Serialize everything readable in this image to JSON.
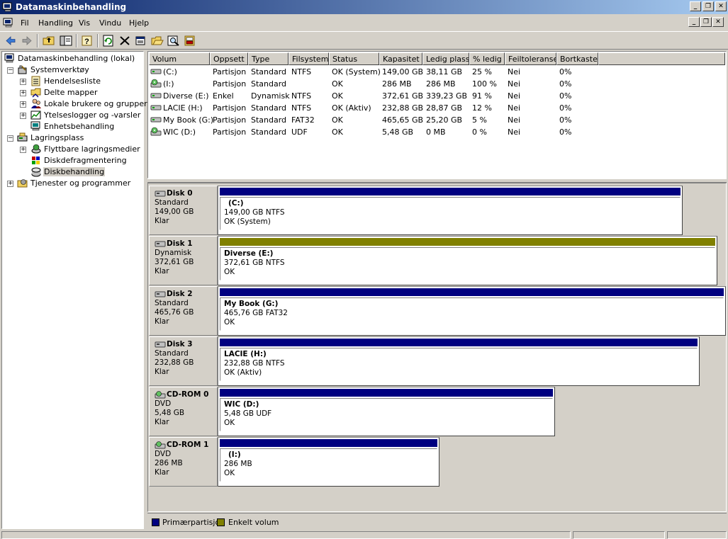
{
  "window": {
    "title": "Datamaskinbehandling"
  },
  "menu": [
    "Fil",
    "Handling",
    "Vis",
    "Vindu",
    "Hjelp"
  ],
  "colors": {
    "primary_partition": "#000080",
    "simple_volume": "#808000",
    "selection": "#d4d0c8"
  },
  "tree": [
    {
      "label": "Datamaskinbehandling (lokal)",
      "icon": "computer-icon"
    },
    {
      "label": "Systemverktøy",
      "icon": "tools-icon"
    },
    {
      "label": "Hendelsesliste",
      "icon": "event-viewer-icon"
    },
    {
      "label": "Delte mapper",
      "icon": "shared-folder-icon"
    },
    {
      "label": "Lokale brukere og grupper",
      "icon": "users-icon"
    },
    {
      "label": "Ytelseslogger og -varsler",
      "icon": "perf-logs-icon"
    },
    {
      "label": "Enhetsbehandling",
      "icon": "device-manager-icon"
    },
    {
      "label": "Lagringsplass",
      "icon": "storage-icon"
    },
    {
      "label": "Flyttbare lagringsmedier",
      "icon": "removable-storage-icon"
    },
    {
      "label": "Diskdefragmentering",
      "icon": "defrag-icon"
    },
    {
      "label": "Diskbehandling",
      "icon": "disk-management-icon"
    },
    {
      "label": "Tjenester og programmer",
      "icon": "services-icon"
    }
  ],
  "volume_table": {
    "columns": [
      "Volum",
      "Oppsett",
      "Type",
      "Filsystem",
      "Status",
      "Kapasitet",
      "Ledig plass",
      "% ledig",
      "Feiltoleranse",
      "Bortkastet"
    ],
    "rows": [
      [
        "(C:)",
        "Partisjon",
        "Standard",
        "NTFS",
        "OK (System)",
        "149,00 GB",
        "38,11 GB",
        "25 %",
        "Nei",
        "0%"
      ],
      [
        "(I:)",
        "Partisjon",
        "Standard",
        "",
        "OK",
        "286 MB",
        "286 MB",
        "100 %",
        "Nei",
        "0%"
      ],
      [
        "Diverse (E:)",
        "Enkel",
        "Dynamisk",
        "NTFS",
        "OK",
        "372,61 GB",
        "339,23 GB",
        "91 %",
        "Nei",
        "0%"
      ],
      [
        "LACIE (H:)",
        "Partisjon",
        "Standard",
        "NTFS",
        "OK (Aktiv)",
        "232,88 GB",
        "28,87 GB",
        "12 %",
        "Nei",
        "0%"
      ],
      [
        "My Book (G:)",
        "Partisjon",
        "Standard",
        "FAT32",
        "OK",
        "465,65 GB",
        "25,20 GB",
        "5 %",
        "Nei",
        "0%"
      ],
      [
        "WIC (D:)",
        "Partisjon",
        "Standard",
        "UDF",
        "OK",
        "5,48 GB",
        "0 MB",
        "0 %",
        "Nei",
        "0%"
      ]
    ]
  },
  "disks": [
    {
      "name": "Disk 0",
      "type": "Standard",
      "size": "149,00 GB",
      "status": "Klar",
      "partition": {
        "name": "(C:)",
        "detail": "149,00 GB NTFS",
        "status": "OK (System)",
        "kind": "primary"
      }
    },
    {
      "name": "Disk 1",
      "type": "Dynamisk",
      "size": "372,61 GB",
      "status": "Klar",
      "partition": {
        "name": "Diverse  (E:)",
        "detail": "372,61 GB NTFS",
        "status": "OK",
        "kind": "simple"
      }
    },
    {
      "name": "Disk 2",
      "type": "Standard",
      "size": "465,76 GB",
      "status": "Klar",
      "partition": {
        "name": "My Book  (G:)",
        "detail": "465,76 GB FAT32",
        "status": "OK",
        "kind": "primary"
      }
    },
    {
      "name": "Disk 3",
      "type": "Standard",
      "size": "232,88 GB",
      "status": "Klar",
      "partition": {
        "name": "LACIE  (H:)",
        "detail": "232,88 GB NTFS",
        "status": "OK (Aktiv)",
        "kind": "primary"
      }
    },
    {
      "name": "CD-ROM 0",
      "type": "DVD",
      "size": "5,48 GB",
      "status": "Klar",
      "partition": {
        "name": "WIC  (D:)",
        "detail": "5,48 GB UDF",
        "status": "OK",
        "kind": "primary"
      }
    },
    {
      "name": "CD-ROM 1",
      "type": "DVD",
      "size": "286 MB",
      "status": "Klar",
      "partition": {
        "name": "(I:)",
        "detail": "286 MB",
        "status": "OK",
        "kind": "primary"
      }
    }
  ],
  "legend": {
    "primary": "Primærpartisjon",
    "simple": "Enkelt volum"
  }
}
